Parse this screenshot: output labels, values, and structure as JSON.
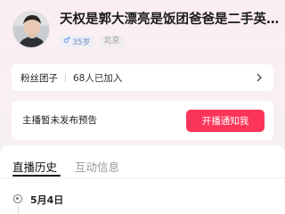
{
  "profile": {
    "name": "天权是郭大漂亮是饭团爸爸是二手英…",
    "gender_symbol": "♂",
    "age": "35岁",
    "city": "北京"
  },
  "fans_group": {
    "label": "粉丝团子",
    "count": "68人已加入"
  },
  "notice": {
    "text": "主播暂未发布预告",
    "button": "开播通知我"
  },
  "tabs": [
    {
      "label": "直播历史",
      "active": true
    },
    {
      "label": "互动信息",
      "active": false
    }
  ],
  "timeline": {
    "date": "5月4日"
  },
  "colors": {
    "accent": "#fb3559",
    "gender": "#5b8fe0"
  }
}
